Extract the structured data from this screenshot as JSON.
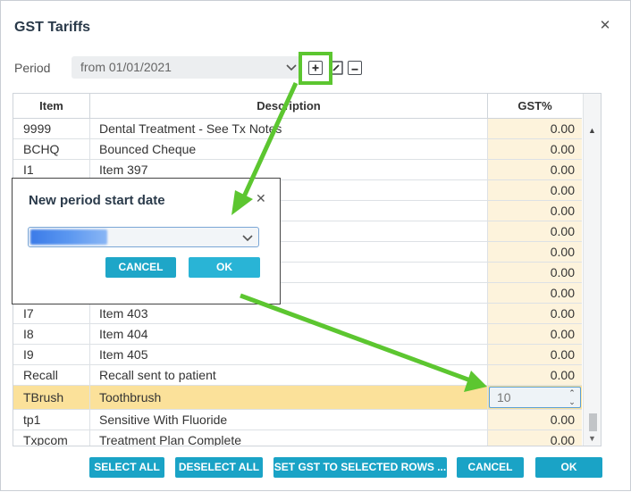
{
  "title": "GST Tariffs",
  "period": {
    "label": "Period",
    "selected": "from 01/01/2021"
  },
  "grid": {
    "headers": [
      "Item",
      "Description",
      "GST%"
    ],
    "rows": [
      {
        "item": "9999",
        "desc": "Dental Treatment - See Tx Notes",
        "gst": "0.00"
      },
      {
        "item": "BCHQ",
        "desc": "Bounced Cheque",
        "gst": "0.00"
      },
      {
        "item": "I1",
        "desc": "Item 397",
        "gst": "0.00"
      },
      {
        "item": "",
        "desc": "",
        "gst": "0.00"
      },
      {
        "item": "",
        "desc": "",
        "gst": "0.00"
      },
      {
        "item": "",
        "desc": "",
        "gst": "0.00"
      },
      {
        "item": "",
        "desc": "",
        "gst": "0.00"
      },
      {
        "item": "",
        "desc": "",
        "gst": "0.00"
      },
      {
        "item": "",
        "desc": "",
        "gst": "0.00"
      },
      {
        "item": "I7",
        "desc": "Item 403",
        "gst": "0.00"
      },
      {
        "item": "I8",
        "desc": "Item 404",
        "gst": "0.00"
      },
      {
        "item": "I9",
        "desc": "Item 405",
        "gst": "0.00"
      },
      {
        "item": "Recall",
        "desc": "Recall sent to patient",
        "gst": "0.00"
      },
      {
        "item": "TBrush",
        "desc": "Toothbrush",
        "gst": "10",
        "selected": true
      },
      {
        "item": "tp1",
        "desc": "Sensitive With Fluoride",
        "gst": "0.00"
      },
      {
        "item": "Txpcom",
        "desc": "Treatment Plan Complete",
        "gst": "0.00"
      }
    ]
  },
  "popup": {
    "title": "New period start date",
    "cancel": "CANCEL",
    "ok": "OK"
  },
  "buttons": {
    "select_all": "SELECT ALL",
    "deselect_all": "DESELECT ALL",
    "set_gst": "SET GST TO SELECTED ROWS ...",
    "cancel": "CANCEL",
    "ok": "OK"
  },
  "colors": {
    "accent": "#1aa3c6",
    "highlight_row": "#fbe19a",
    "gst_column": "#fdf3dc",
    "annotation_green": "#5cc630"
  },
  "icons": [
    "close-icon",
    "chevron-down-icon",
    "add-icon",
    "edit-icon",
    "minus-icon",
    "spin-icon"
  ]
}
